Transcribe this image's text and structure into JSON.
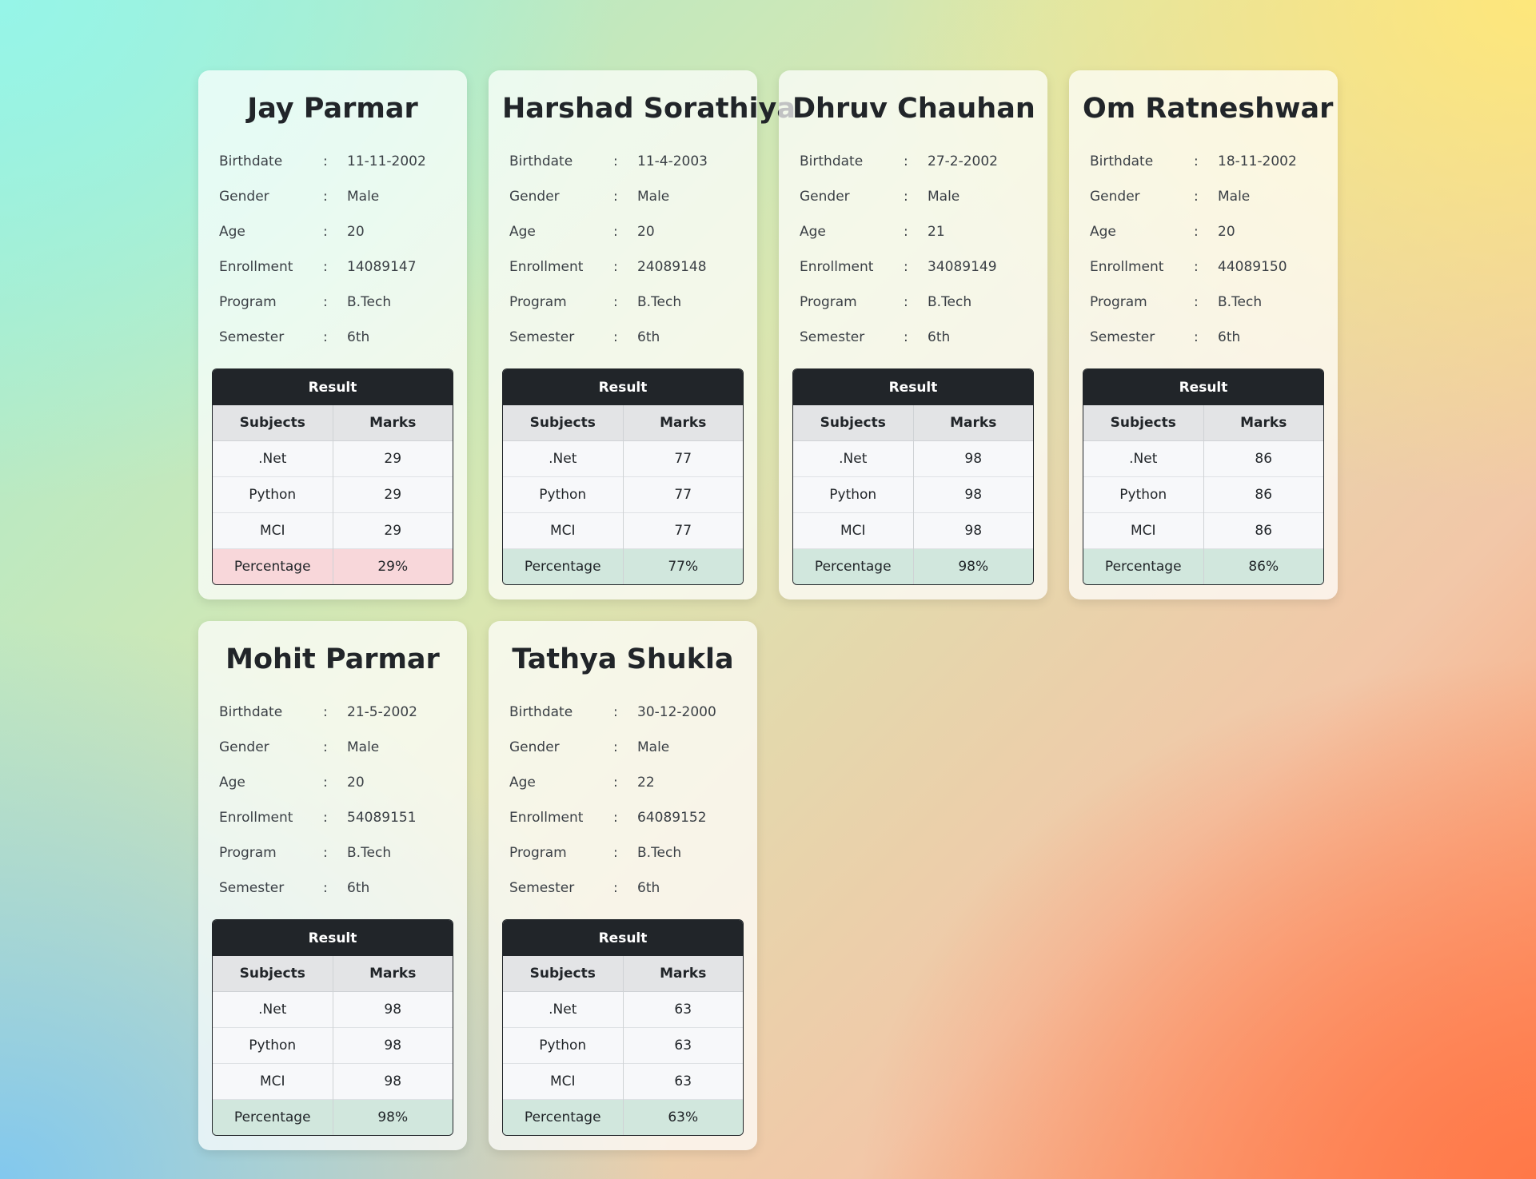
{
  "labels": {
    "birthdate": "Birthdate",
    "gender": "Gender",
    "age": "Age",
    "enrollment": "Enrollment",
    "program": "Program",
    "semester": "Semester",
    "colon": ":",
    "result": "Result",
    "subjects": "Subjects",
    "marks": "Marks",
    "percentage": "Percentage"
  },
  "students": [
    {
      "name": "Jay Parmar",
      "birthdate": "11-11-2002",
      "gender": "Male",
      "age": "20",
      "enrollment": "14089147",
      "program": "B.Tech",
      "semester": "6th",
      "subjects": [
        {
          "name": ".Net",
          "marks": "29"
        },
        {
          "name": "Python",
          "marks": "29"
        },
        {
          "name": "MCI",
          "marks": "29"
        }
      ],
      "percentage": "29%",
      "status": "fail"
    },
    {
      "name": "Harshad Sorathiya",
      "birthdate": "11-4-2003",
      "gender": "Male",
      "age": "20",
      "enrollment": "24089148",
      "program": "B.Tech",
      "semester": "6th",
      "subjects": [
        {
          "name": ".Net",
          "marks": "77"
        },
        {
          "name": "Python",
          "marks": "77"
        },
        {
          "name": "MCI",
          "marks": "77"
        }
      ],
      "percentage": "77%",
      "status": "pass"
    },
    {
      "name": "Dhruv Chauhan",
      "birthdate": "27-2-2002",
      "gender": "Male",
      "age": "21",
      "enrollment": "34089149",
      "program": "B.Tech",
      "semester": "6th",
      "subjects": [
        {
          "name": ".Net",
          "marks": "98"
        },
        {
          "name": "Python",
          "marks": "98"
        },
        {
          "name": "MCI",
          "marks": "98"
        }
      ],
      "percentage": "98%",
      "status": "pass"
    },
    {
      "name": "Om Ratneshwar",
      "birthdate": "18-11-2002",
      "gender": "Male",
      "age": "20",
      "enrollment": "44089150",
      "program": "B.Tech",
      "semester": "6th",
      "subjects": [
        {
          "name": ".Net",
          "marks": "86"
        },
        {
          "name": "Python",
          "marks": "86"
        },
        {
          "name": "MCI",
          "marks": "86"
        }
      ],
      "percentage": "86%",
      "status": "pass"
    },
    {
      "name": "Mohit Parmar",
      "birthdate": "21-5-2002",
      "gender": "Male",
      "age": "20",
      "enrollment": "54089151",
      "program": "B.Tech",
      "semester": "6th",
      "subjects": [
        {
          "name": ".Net",
          "marks": "98"
        },
        {
          "name": "Python",
          "marks": "98"
        },
        {
          "name": "MCI",
          "marks": "98"
        }
      ],
      "percentage": "98%",
      "status": "pass"
    },
    {
      "name": "Tathya Shukla",
      "birthdate": "30-12-2000",
      "gender": "Male",
      "age": "22",
      "enrollment": "64089152",
      "program": "B.Tech",
      "semester": "6th",
      "subjects": [
        {
          "name": ".Net",
          "marks": "63"
        },
        {
          "name": "Python",
          "marks": "63"
        },
        {
          "name": "MCI",
          "marks": "63"
        }
      ],
      "percentage": "63%",
      "status": "pass"
    }
  ],
  "colors": {
    "header": "#212529",
    "pass_row": "#d1e7dd",
    "fail_row": "#f8d7da"
  }
}
